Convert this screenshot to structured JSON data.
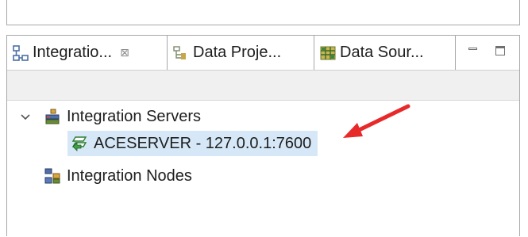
{
  "tabs": [
    {
      "label": "Integratio...",
      "icon": "integration-explorer-icon",
      "active": true
    },
    {
      "label": "Data Proje...",
      "icon": "data-project-icon",
      "active": false
    },
    {
      "label": "Data Sour...",
      "icon": "data-source-icon",
      "active": false
    }
  ],
  "tree": {
    "servers_label": "Integration Servers",
    "server_item": "ACESERVER - 127.0.0.1:7600",
    "nodes_label": "Integration Nodes"
  },
  "colors": {
    "selection": "#d6e8f7",
    "arrow": "#e8292a"
  }
}
